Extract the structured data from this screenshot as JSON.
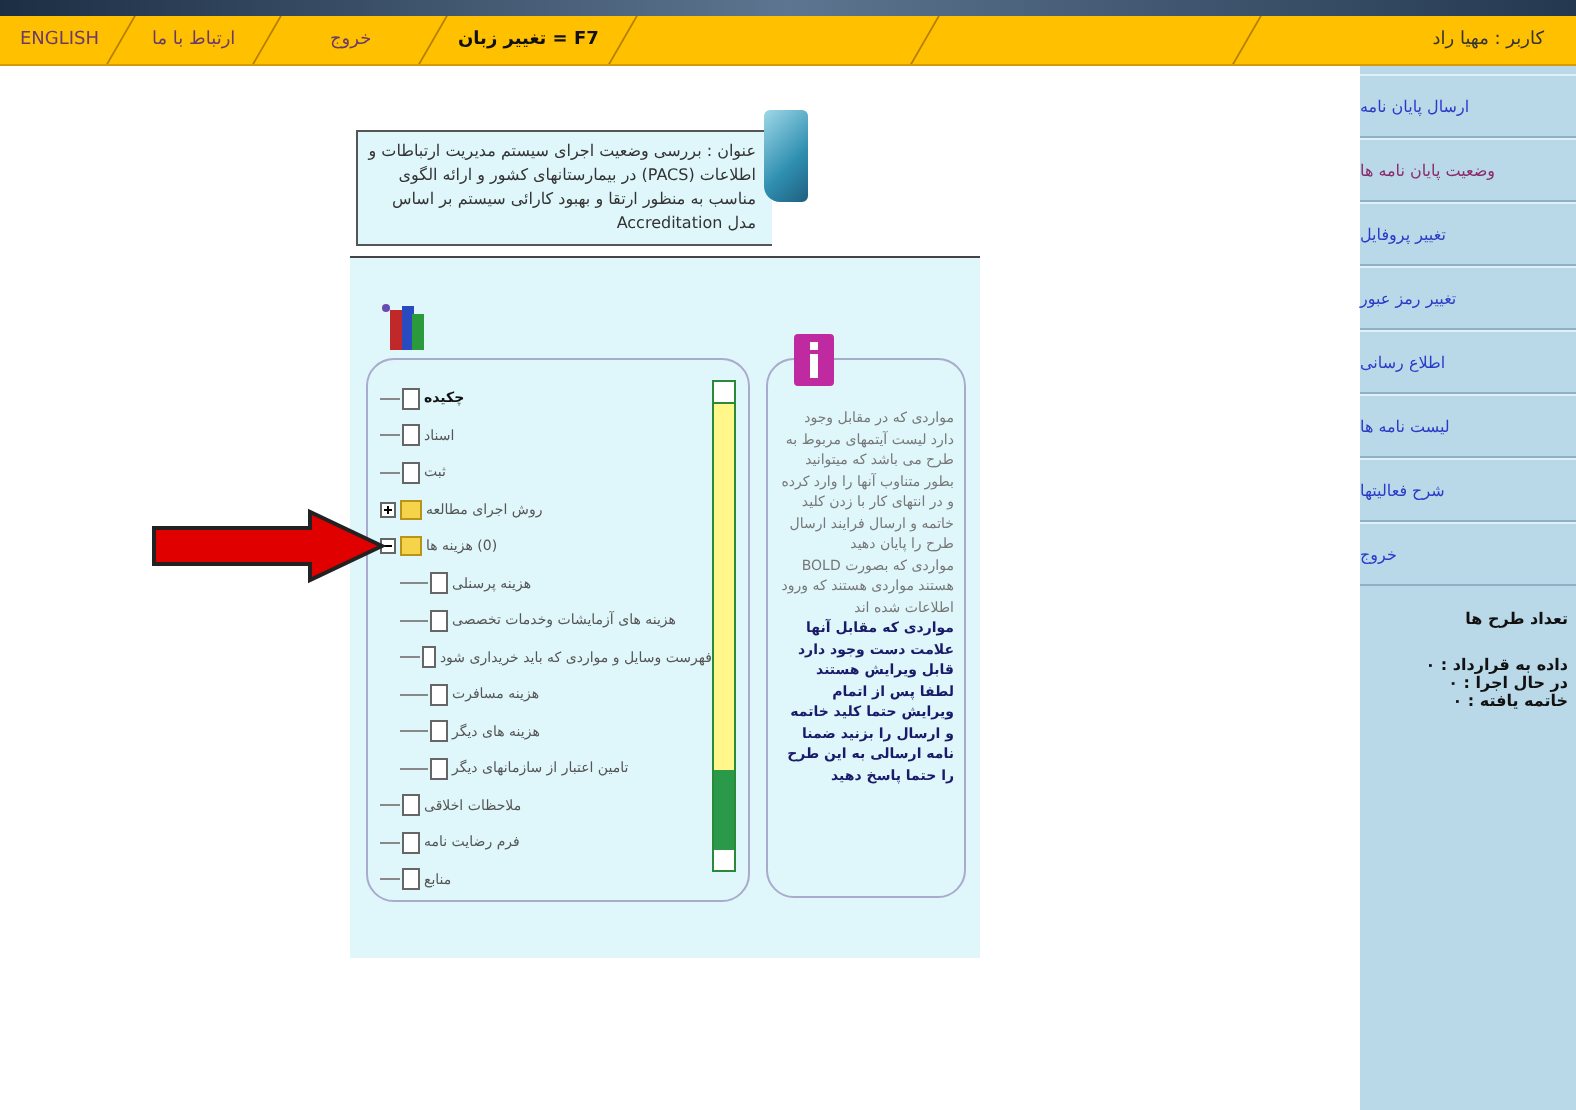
{
  "top_bar": {
    "items": [
      {
        "label": "F7 = تغییر زبان",
        "bold": true
      },
      {
        "label": "خروج",
        "bold": false
      },
      {
        "label": "ارتباط با ما",
        "bold": false
      },
      {
        "label": "ENGLISH",
        "bold": false
      }
    ],
    "user": "کاربر : مهیا راد"
  },
  "title_box": {
    "text": "عنوان : بررسی وضعیت اجرای سیستم مدیریت ارتباطات و اطلاعات (PACS) در بیمارستانهای کشور و ارائه الگوی مناسب به منظور ارتقا و بهبود کارائی سیستم بر اساس مدل Accreditation"
  },
  "tree": [
    {
      "kind": "doc",
      "label": "چکیده",
      "bold": true
    },
    {
      "kind": "doc",
      "label": "اسناد",
      "bold": false
    },
    {
      "kind": "doc",
      "label": "ثبت",
      "bold": false
    },
    {
      "kind": "folder",
      "label": "روش اجرای مطالعه",
      "bold": false,
      "expanded": false
    },
    {
      "kind": "folder",
      "label": "(0) هزینه ها",
      "bold": false,
      "expanded": true,
      "children": [
        {
          "kind": "doc",
          "label": "هزینه پرسنلی",
          "bold": false
        },
        {
          "kind": "doc",
          "label": "هزینه های آزمایشات وخدمات تخصصی",
          "bold": false
        },
        {
          "kind": "doc",
          "label": "فهرست وسایل و مواردی که باید خریداری شود",
          "bold": false
        },
        {
          "kind": "doc",
          "label": "هزینه مسافرت",
          "bold": false
        },
        {
          "kind": "doc",
          "label": "هزینه های دیگر",
          "bold": false
        },
        {
          "kind": "doc",
          "label": "تامین اعتبار از سازمانهای دیگر",
          "bold": false
        }
      ]
    },
    {
      "kind": "doc",
      "label": "ملاحظات اخلاقی",
      "bold": false
    },
    {
      "kind": "doc",
      "label": "فرم رضایت نامه",
      "bold": false
    },
    {
      "kind": "doc",
      "label": "منابع",
      "bold": false
    }
  ],
  "info": [
    {
      "text": "مواردی که در مقابل وجود دارد لیست آیتمهای مربوط به طرح می باشد که میتوانید بطور متناوب آنها را وارد کرده و در انتهای کار با زدن کلید خاتمه و ارسال فرایند ارسال طرح را پایان دهید",
      "bold": false
    },
    {
      "text": "مواردی که بصورت BOLD هستند مواردی هستند که ورود اطلاعات شده اند",
      "bold": false
    },
    {
      "text": "مواردی که مقابل آنها علامت دست وجود دارد قابل ویرایش هستند",
      "bold": true
    },
    {
      "text": "لطفا پس از اتمام ویرایش حتما کلید خاتمه و ارسال را بزنید ضمنا نامه ارسالی به این طرح را حتما پاسخ دهید",
      "bold": true
    }
  ],
  "sidebar": {
    "items": [
      "ارسال پایان نامه",
      "وضعیت پایان نامه ها",
      "تغییر پروفایل",
      "تغییر رمز عبور",
      "اطلاع رسانی",
      "لیست نامه ها",
      "شرح فعالیتها",
      "خروج"
    ],
    "stats_title": "تعداد طرح ها",
    "stats": [
      "داده به قرارداد : ۰",
      "در حال اجرا : ۰",
      "خاتمه یافته : ۰"
    ]
  }
}
